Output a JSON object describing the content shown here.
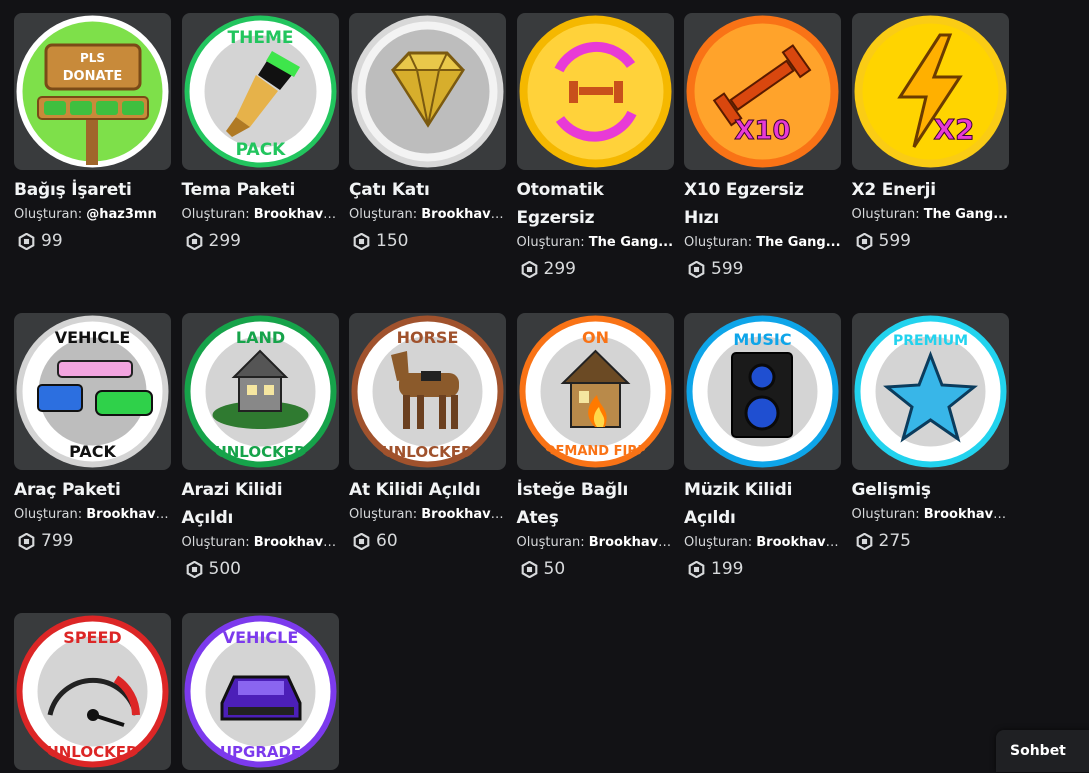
{
  "items": [
    {
      "name": "Bağış İşareti",
      "creator_label": "Oluşturan:",
      "creator": "@haz3mn",
      "price": "99",
      "icon": "pls-donate-sign-icon",
      "ring": "#ffffff"
    },
    {
      "name": "Tema Paketi",
      "creator_label": "Oluşturan:",
      "creator": "Brookhaven...",
      "price": "299",
      "icon": "theme-pack-brush-icon",
      "ring": "#22c55e"
    },
    {
      "name": "Çatı Katı",
      "creator_label": "Oluşturan:",
      "creator": "Brookhaven...",
      "price": "150",
      "icon": "diamond-icon",
      "ring": "#e5e5e5"
    },
    {
      "name": "Otomatik Egzersiz",
      "creator_label": "Oluşturan:",
      "creator": "The Gang...",
      "price": "299",
      "icon": "auto-workout-dumbbell-icon",
      "ring": "#f5b800"
    },
    {
      "name": "X10 Egzersiz Hızı",
      "creator_label": "Oluşturan:",
      "creator": "The Gang...",
      "price": "599",
      "icon": "x10-dumbbell-icon",
      "ring": "#f97316"
    },
    {
      "name": "X2 Enerji",
      "creator_label": "Oluşturan:",
      "creator": "The Gang...",
      "price": "599",
      "icon": "x2-lightning-icon",
      "ring": "#facc15"
    },
    {
      "name": "Araç Paketi",
      "creator_label": "Oluşturan:",
      "creator": "Brookhaven...",
      "price": "799",
      "icon": "vehicle-pack-cars-icon",
      "ring": "#e5e5e5"
    },
    {
      "name": "Arazi Kilidi Açıldı",
      "creator_label": "Oluşturan:",
      "creator": "Brookhaven...",
      "price": "500",
      "icon": "land-unlocked-house-icon",
      "ring": "#16a34a"
    },
    {
      "name": "At Kilidi Açıldı",
      "creator_label": "Oluşturan:",
      "creator": "Brookhaven...",
      "price": "60",
      "icon": "horse-unlocked-icon",
      "ring": "#a0522d"
    },
    {
      "name": "İsteğe Bağlı Ateş",
      "creator_label": "Oluşturan:",
      "creator": "Brookhaven...",
      "price": "50",
      "icon": "on-demand-fire-house-icon",
      "ring": "#f97316"
    },
    {
      "name": "Müzik Kilidi Açıldı",
      "creator_label": "Oluşturan:",
      "creator": "Brookhaven...",
      "price": "199",
      "icon": "music-speaker-icon",
      "ring": "#0ea5e9"
    },
    {
      "name": "Gelişmiş",
      "creator_label": "Oluşturan:",
      "creator": "Brookhaven...",
      "price": "275",
      "icon": "premium-star-icon",
      "ring": "#22d3ee"
    },
    {
      "name": "",
      "creator_label": "",
      "creator": "",
      "price": "",
      "icon": "speed-unlocked-gauge-icon",
      "ring": "#dc2626"
    },
    {
      "name": "",
      "creator_label": "",
      "creator": "",
      "price": "",
      "icon": "vehicle-upgrade-car-icon",
      "ring": "#7c3aed"
    }
  ],
  "badge_texts": {
    "donate_top": "PLS",
    "donate_bottom": "DONATE",
    "theme_top": "THEME",
    "theme_bottom": "PACK",
    "vehicle_top": "VEHICLE",
    "vehicle_bottom": "PACK",
    "land_top": "LAND",
    "land_bottom": "UNLOCKED",
    "horse_top": "HORSE",
    "horse_bottom": "UNLOCKED",
    "fire_top": "ON",
    "fire_bottom": "DEMAND FIRE",
    "music_top": "MUSIC",
    "premium_top": "PREMIUM",
    "speed_top": "SPEED",
    "speed_bottom": "UNLOCKED",
    "upgrade_top": "VEHICLE",
    "upgrade_bottom": "UPGRADE",
    "x10": "X10",
    "x2": "X2"
  },
  "chat": {
    "label": "Sohbet"
  }
}
